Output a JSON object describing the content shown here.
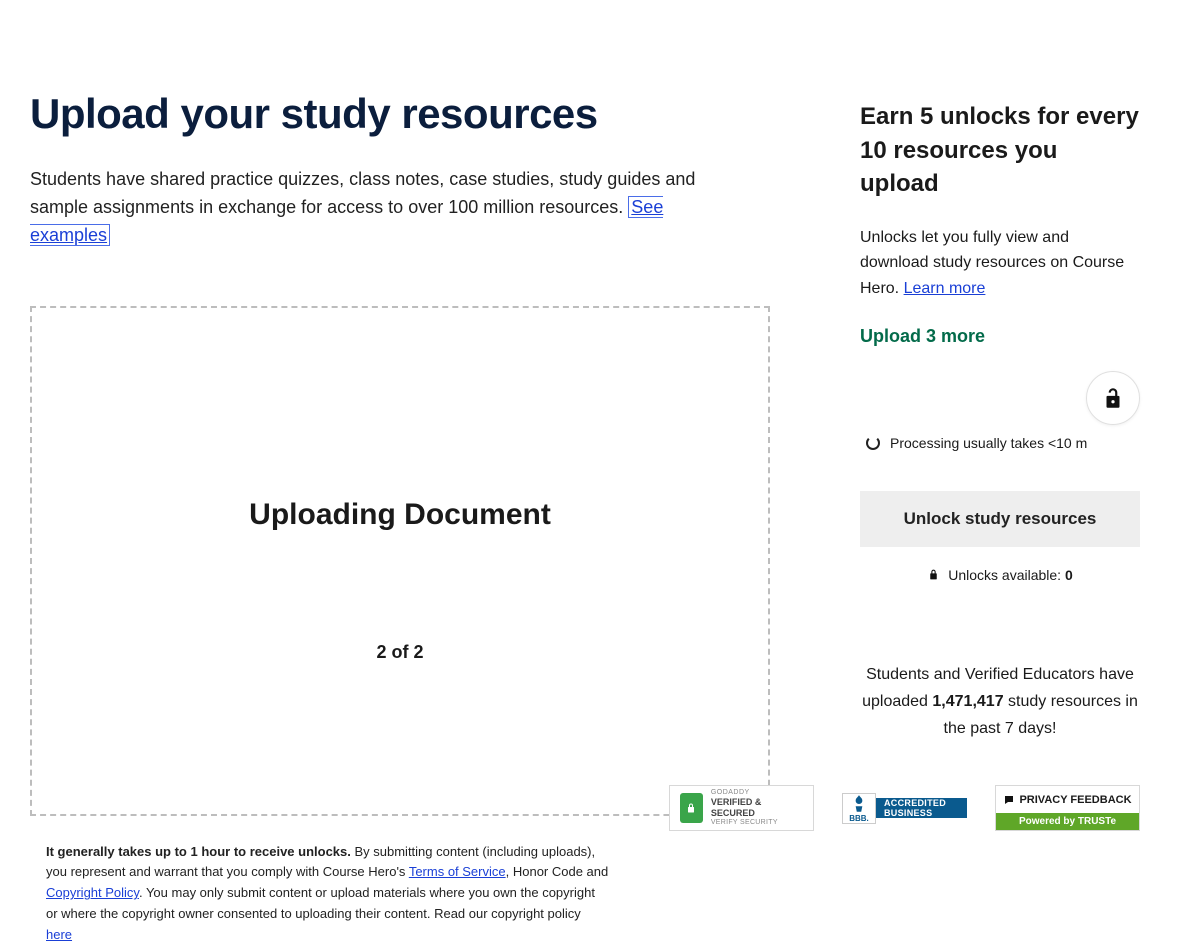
{
  "main": {
    "heading": "Upload your study resources",
    "subtitle_prefix": "Students have shared practice quizzes, class notes, case studies, study guides and sample assignments in exchange for access to over 100 million resources. ",
    "see_examples": "See examples",
    "dropzone": {
      "title": "Uploading Document",
      "counter": "2 of 2"
    },
    "legal": {
      "bold": "It generally takes up to 1 hour to receive unlocks.",
      "text1": " By submitting content (including uploads), you represent and warrant that you comply with Course Hero's ",
      "tos": "Terms of Service",
      "text2": ", Honor Code and ",
      "copyright": "Copyright Policy",
      "text3": ". You may only submit content or upload materials where you own the copyright or where the copyright owner consented to uploading their content. Read our copyright policy ",
      "here": "here"
    }
  },
  "sidebar": {
    "title": "Earn 5 unlocks for every 10 resources you upload",
    "desc_prefix": "Unlocks let you fully view and download study resources on Course Hero. ",
    "learn_more": "Learn more",
    "upload_more": "Upload 3 more",
    "processing": "Processing usually takes <10 m",
    "unlock_btn": "Unlock study resources",
    "unlocks_avail_label": "Unlocks available: ",
    "unlocks_avail_count": "0",
    "stats_prefix": "Students and Verified Educators have uploaded ",
    "stats_number": "1,471,417",
    "stats_suffix": " study resources in the past 7 days!"
  },
  "badges": {
    "godaddy_top": "GODADDY",
    "godaddy_mid": "VERIFIED & SECURED",
    "godaddy_bot": "VERIFY SECURITY",
    "bbb_label": "BBB.",
    "bbb_line1": "ACCREDITED",
    "bbb_line2": "BUSINESS",
    "truste_top": "PRIVACY FEEDBACK",
    "truste_bot": "Powered by TRUSTe"
  }
}
